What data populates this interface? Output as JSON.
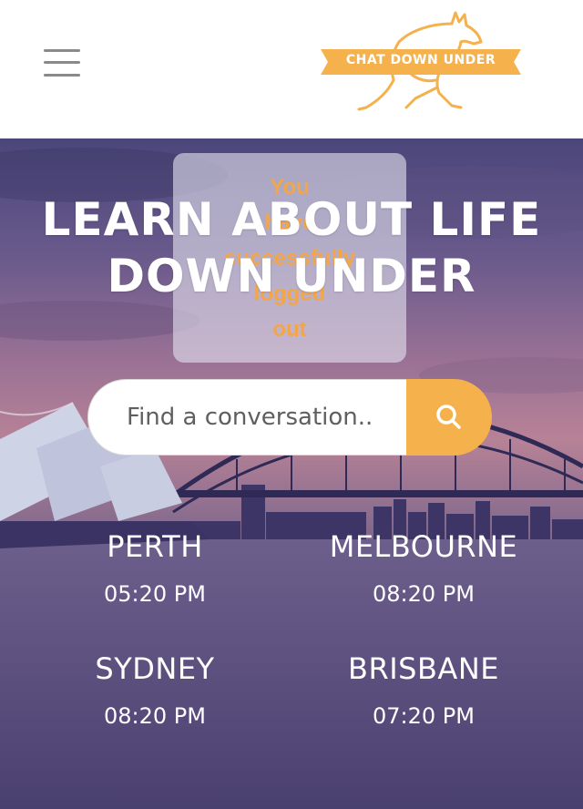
{
  "header": {
    "menu_icon": "hamburger-menu-icon",
    "logo": {
      "text": "CHAT DOWN UNDER",
      "icon": "kangaroo-icon"
    }
  },
  "toast": {
    "lines": [
      "You",
      "have",
      "successfully",
      "logged",
      "out"
    ]
  },
  "hero": {
    "title_lines": [
      "LEARN ABOUT LIFE",
      "DOWN UNDER"
    ],
    "background": "sydney-opera-house-harbour-bridge-sunset"
  },
  "search": {
    "placeholder": "Find a conversation..",
    "button_icon": "search-icon"
  },
  "cities": [
    {
      "name": "PERTH",
      "time": "05:20 PM"
    },
    {
      "name": "MELBOURNE",
      "time": "08:20 PM"
    },
    {
      "name": "SYDNEY",
      "time": "08:20 PM"
    },
    {
      "name": "BRISBANE",
      "time": "07:20 PM"
    }
  ],
  "colors": {
    "accent": "#f4b14c",
    "toast_text": "#f3a54a",
    "menu_icon": "#8a8a8a",
    "hero_text": "#ffffff"
  }
}
